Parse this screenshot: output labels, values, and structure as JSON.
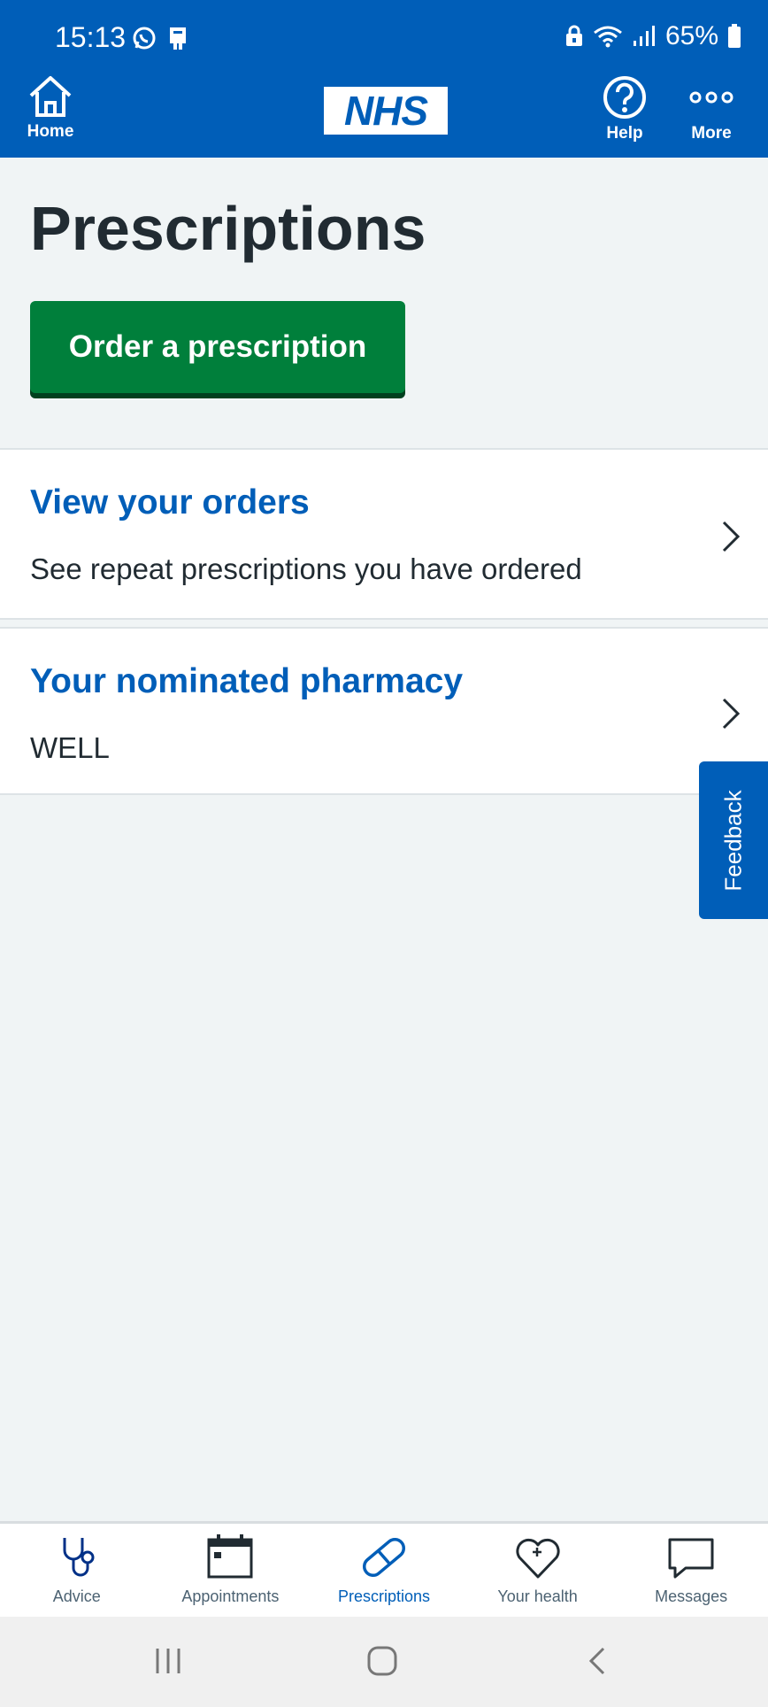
{
  "status_bar": {
    "time": "15:13",
    "battery": "65%"
  },
  "header": {
    "home_label": "Home",
    "logo_text": "NHS",
    "help_label": "Help",
    "more_label": "More"
  },
  "main": {
    "title": "Prescriptions",
    "order_button": "Order a prescription",
    "cards": [
      {
        "title": "View your orders",
        "subtitle": "See repeat prescriptions you have ordered"
      },
      {
        "title": "Your nominated pharmacy",
        "subtitle": "WELL"
      }
    ],
    "feedback_label": "Feedback"
  },
  "tabbar": {
    "items": [
      {
        "label": "Advice",
        "icon": "stethoscope-icon"
      },
      {
        "label": "Appointments",
        "icon": "calendar-icon"
      },
      {
        "label": "Prescriptions",
        "icon": "pill-icon",
        "active": true
      },
      {
        "label": "Your health",
        "icon": "heart-icon"
      },
      {
        "label": "Messages",
        "icon": "speech-bubble-icon"
      }
    ]
  },
  "colors": {
    "brand_blue": "#005eb8",
    "button_green": "#007f3b",
    "background": "#f0f4f5",
    "text_dark": "#212b32"
  }
}
